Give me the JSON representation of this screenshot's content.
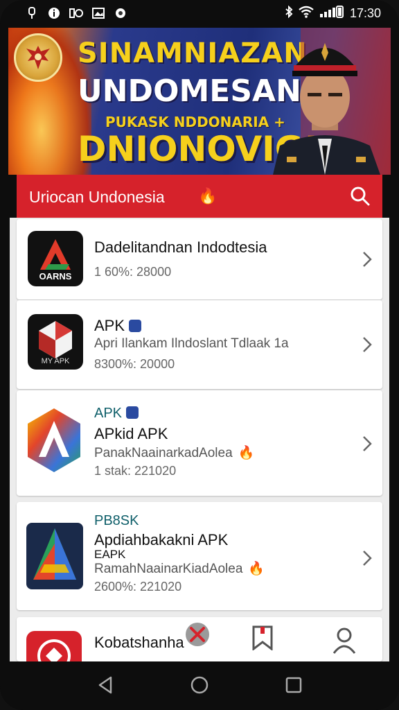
{
  "status_bar": {
    "time": "17:30"
  },
  "banner": {
    "line1": "SINAMNIAZAN",
    "line2": "UNDOMESAN",
    "line3": "PUKASK NDDONARIA +",
    "line4": "DNIONOVIG!"
  },
  "header": {
    "title": "Uriocan Undonesia"
  },
  "apps": [
    {
      "title": "Dadelitandnan Indodtesia",
      "icon_label": "OARNS",
      "meta": "1 60%: 28000"
    },
    {
      "title": "APK",
      "subtitle": "Apri Ilankam Ilndoslant Tdlaak 1a",
      "icon_label": "MY APK",
      "meta": "8300%: 20000"
    },
    {
      "label": "APK",
      "title": "APkid APK",
      "subtitle": "PanakNaainarkadAolea",
      "meta": "1 stak: 221020"
    },
    {
      "label": "PB8SK",
      "title": "Apdiahbakakni APK",
      "title2": "EAPK",
      "subtitle": "RamahNaainarKiadAolea",
      "meta": "2600%: 221020"
    },
    {
      "title": "Kobatshanha"
    }
  ],
  "colors": {
    "accent": "#d6222b",
    "banner_blue": "#1f2f7a",
    "flag_yellow": "#f6d01c"
  }
}
